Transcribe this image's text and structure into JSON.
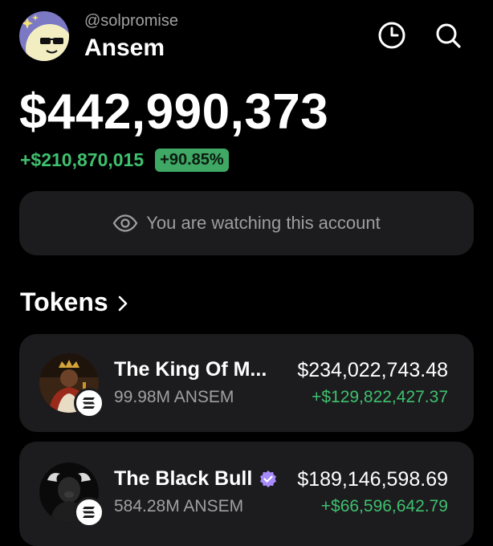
{
  "account": {
    "handle": "@solpromise",
    "name": "Ansem",
    "avatar_icon": "smiling-face-with-sunglasses-avatar",
    "avatar_color": "#f3eec2"
  },
  "header_actions": {
    "history_icon": "clock-icon",
    "search_icon": "search-icon"
  },
  "portfolio": {
    "balance": "$442,990,373",
    "change_amount": "+$210,870,015",
    "change_percent": "+90.85%"
  },
  "watch_banner": {
    "icon": "eye-icon",
    "text": "You are watching this account"
  },
  "tokens_section": {
    "title": "Tokens",
    "chevron_icon": "chevron-right-icon"
  },
  "tokens": [
    {
      "name": "The King Of M...",
      "amount": "99.98M ANSEM",
      "value": "$234,022,743.48",
      "change": "+$129,822,427.37",
      "verified": false,
      "chain_icon": "solana-icon"
    },
    {
      "name": "The Black Bull",
      "amount": "584.28M ANSEM",
      "value": "$189,146,598.69",
      "change": "+$66,596,642.79",
      "verified": true,
      "verified_icon": "verified-badge-icon",
      "chain_icon": "solana-icon"
    }
  ],
  "colors": {
    "background": "#000000",
    "card": "#1c1c1e",
    "positive": "#3fc06e",
    "positive_badge": "#3fa864",
    "muted_text": "#a0a0a0",
    "verified": "#a78bfa"
  }
}
